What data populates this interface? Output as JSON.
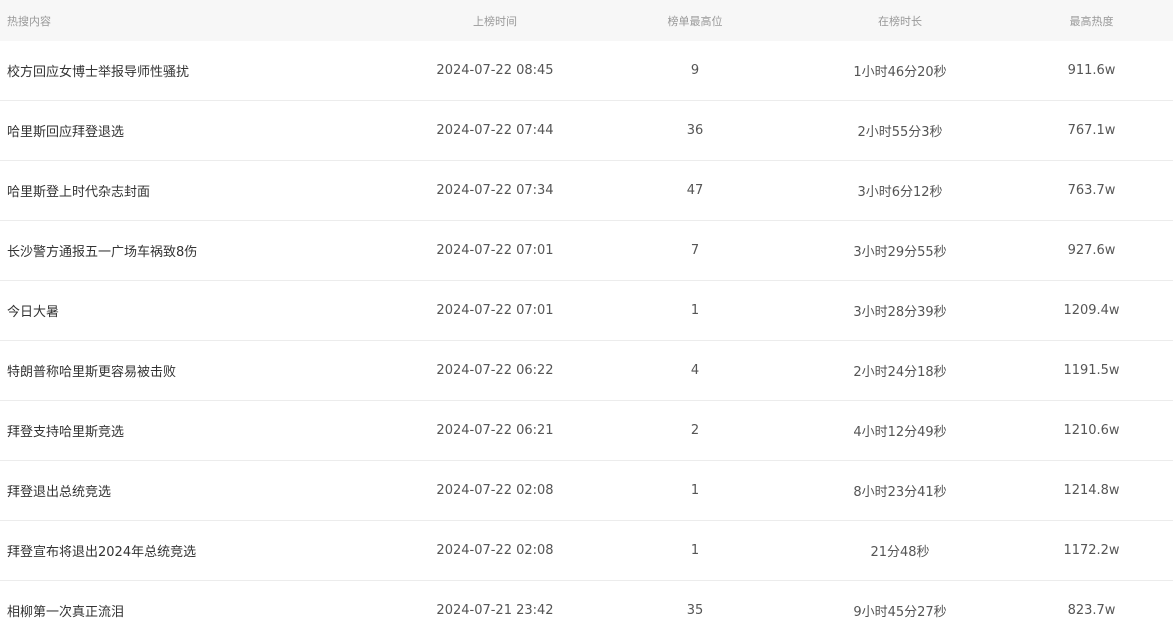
{
  "header": {
    "topic": "热搜内容",
    "time": "上榜时间",
    "best_rank": "榜单最高位",
    "duration": "在榜时长",
    "peak_heat": "最高热度"
  },
  "rows": [
    {
      "topic": "校方回应女博士举报导师性骚扰",
      "time": "2024-07-22 08:45",
      "best_rank": "9",
      "duration": "1小时46分20秒",
      "peak_heat": "911.6w"
    },
    {
      "topic": "哈里斯回应拜登退选",
      "time": "2024-07-22 07:44",
      "best_rank": "36",
      "duration": "2小时55分3秒",
      "peak_heat": "767.1w"
    },
    {
      "topic": "哈里斯登上时代杂志封面",
      "time": "2024-07-22 07:34",
      "best_rank": "47",
      "duration": "3小时6分12秒",
      "peak_heat": "763.7w"
    },
    {
      "topic": "长沙警方通报五一广场车祸致8伤",
      "time": "2024-07-22 07:01",
      "best_rank": "7",
      "duration": "3小时29分55秒",
      "peak_heat": "927.6w"
    },
    {
      "topic": "今日大暑",
      "time": "2024-07-22 07:01",
      "best_rank": "1",
      "duration": "3小时28分39秒",
      "peak_heat": "1209.4w"
    },
    {
      "topic": "特朗普称哈里斯更容易被击败",
      "time": "2024-07-22 06:22",
      "best_rank": "4",
      "duration": "2小时24分18秒",
      "peak_heat": "1191.5w"
    },
    {
      "topic": "拜登支持哈里斯竞选",
      "time": "2024-07-22 06:21",
      "best_rank": "2",
      "duration": "4小时12分49秒",
      "peak_heat": "1210.6w"
    },
    {
      "topic": "拜登退出总统竞选",
      "time": "2024-07-22 02:08",
      "best_rank": "1",
      "duration": "8小时23分41秒",
      "peak_heat": "1214.8w"
    },
    {
      "topic": "拜登宣布将退出2024年总统竞选",
      "time": "2024-07-22 02:08",
      "best_rank": "1",
      "duration": "21分48秒",
      "peak_heat": "1172.2w"
    },
    {
      "topic": "相柳第一次真正流泪",
      "time": "2024-07-21 23:42",
      "best_rank": "35",
      "duration": "9小时45分27秒",
      "peak_heat": "823.7w"
    }
  ]
}
